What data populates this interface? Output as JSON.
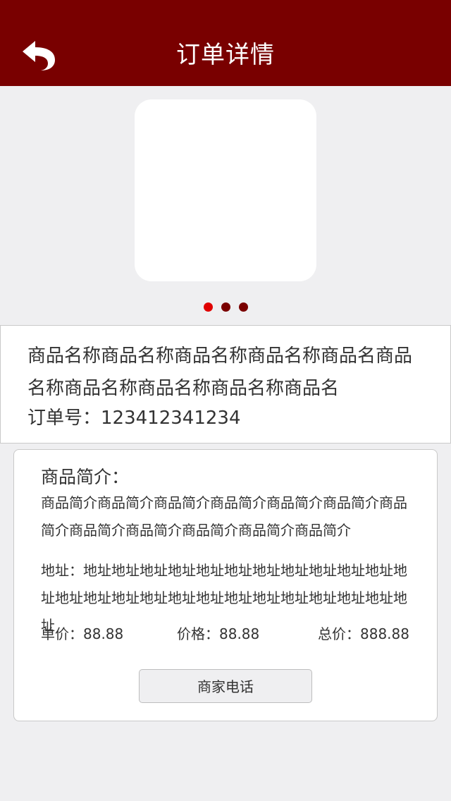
{
  "header": {
    "title": "订单详情",
    "back_icon": "back-arrow-icon"
  },
  "gallery": {
    "image_alt": "",
    "dots": [
      {
        "active": true
      },
      {
        "active": false
      },
      {
        "active": false
      }
    ],
    "colors": {
      "active_dot": "#e00000",
      "inactive_dot": "#7a0000"
    }
  },
  "product": {
    "name": "商品名称商品名称商品名称商品名称商品名商品名称商品名称商品名称商品名称商品名",
    "order_label": "订单号：",
    "order_number": "123412341234"
  },
  "detail": {
    "intro_heading": "商品简介：",
    "intro_text": "商品简介商品简介商品简介商品简介商品简介商品简介商品简介商品简介商品简介商品简介商品简介商品简介",
    "address_label": "地址：",
    "address_text": "地址地址地址地址地址地址地址地址地址地址地址地址地址地址地址地址地址地址地址地址地址地址地址地址地址",
    "unit_price_label": "单价：",
    "unit_price": "88.88",
    "price_label": "价格：",
    "price": "88.88",
    "total_label": "总价：",
    "total": "888.88",
    "call_button": "商家电话"
  },
  "theme": {
    "nav_color": "#790000",
    "background": "#efeff1"
  }
}
